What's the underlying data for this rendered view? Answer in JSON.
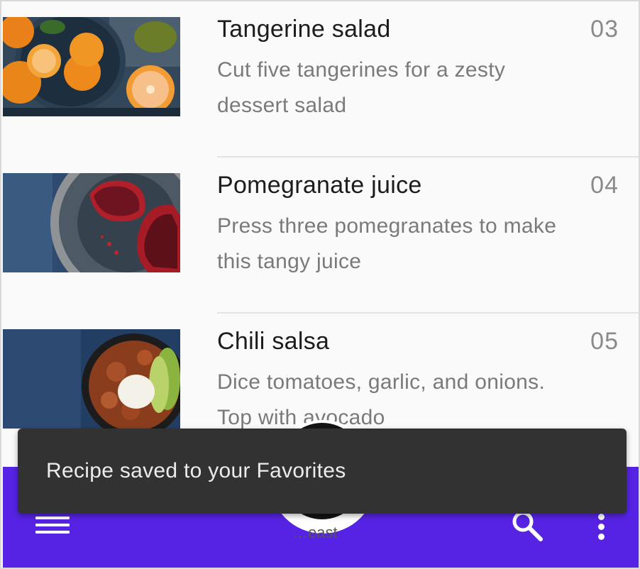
{
  "recipes": [
    {
      "title": "Tangerine salad",
      "number": "03",
      "description": "Cut five tangerines for a zesty dessert salad",
      "image": "tangerines-photo"
    },
    {
      "title": "Pomegranate juice",
      "number": "04",
      "description": "Press three pomegranates to make this tangy juice",
      "image": "pomegranate-photo"
    },
    {
      "title": "Chili salsa",
      "number": "05",
      "description": "Dice tomatoes, garlic, and onions. Top with avocado",
      "image": "chili-salsa-photo"
    }
  ],
  "snackbar": {
    "message": "Recipe saved to your Favorites"
  },
  "bottom_bar": {
    "color": "#5623e4",
    "fab_label_partial": "…east",
    "icons": [
      "menu-icon",
      "search-icon",
      "more-vert-icon"
    ]
  },
  "colors": {
    "background": "#fafafa",
    "snackbar": "#323232"
  }
}
